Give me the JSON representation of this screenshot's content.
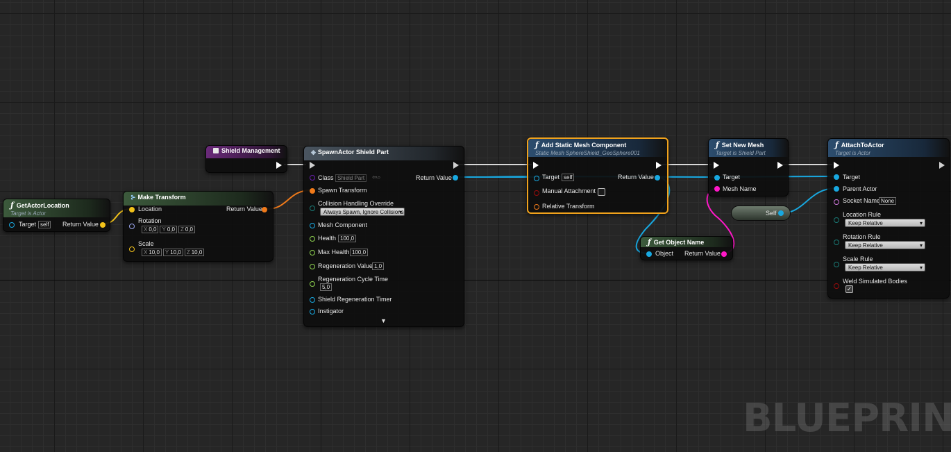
{
  "colors": {
    "exec": "#ffffff",
    "object_pin": "#18a8e0",
    "vector_pin": "#f2c21a",
    "rotator_pin": "#9aa6ee",
    "transform_pin": "#f07a1a",
    "float_pin": "#8ed250",
    "class_pin": "#6a1fb0",
    "enum_pin": "#1a7a76",
    "name_pin": "#d47ae0",
    "string_pin": "#ff18c8",
    "bool_pin": "#9a0c0c",
    "selected": "#f0a21c",
    "wire_blue": "#18a8e0",
    "wire_orange": "#f07a1a",
    "wire_yellow": "#f2c21a",
    "wire_pink": "#ff18c8"
  },
  "nodes": {
    "get_actor_location": {
      "icon": "function-icon",
      "title": "GetActorLocation",
      "subtitle": "Target is Actor",
      "target_label": "Target",
      "target_value": "self",
      "return_label": "Return Value"
    },
    "make_transform": {
      "icon": "make-struct-icon",
      "title": "Make Transform",
      "location_label": "Location",
      "rotation_label": "Rotation",
      "rotation": {
        "x": "0,0",
        "y": "0,0",
        "z": "0,0"
      },
      "scale_label": "Scale",
      "scale": {
        "x": "10,0",
        "y": "10,0",
        "z": "10,0"
      },
      "return_label": "Return Value",
      "x_label": "X",
      "y_label": "Y",
      "z_label": "Z"
    },
    "shield_management": {
      "icon": "event-icon",
      "title": "Shield Management"
    },
    "spawn_actor": {
      "icon": "spawn-icon",
      "title": "SpawnActor Shield Part",
      "class_label": "Class",
      "class_value": "Shield Part",
      "return_label": "Return Value",
      "spawn_transform_label": "Spawn Transform",
      "collision_label": "Collision Handling Override",
      "collision_value": "Always Spawn, Ignore Collisions",
      "mesh_component_label": "Mesh Component",
      "health_label": "Health",
      "health_value": "100,0",
      "max_health_label": "Max Health",
      "max_health_value": "100,0",
      "regen_value_label": "Regeneration Value",
      "regen_value": "1,0",
      "regen_cycle_label": "Regeneration Cycle Time",
      "regen_cycle_value": "5,0",
      "regen_timer_label": "Shield Regeneration Timer",
      "instigator_label": "Instigator"
    },
    "add_static_mesh": {
      "icon": "function-icon",
      "title": "Add Static Mesh Component",
      "subtitle": "Static Mesh SphereShield_GeoSphere001",
      "target_label": "Target",
      "target_value": "self",
      "return_label": "Return Value",
      "manual_attachment_label": "Manual Attachment",
      "manual_attachment_checked": false,
      "relative_transform_label": "Relative Transform"
    },
    "set_new_mesh": {
      "icon": "function-icon",
      "title": "Set New Mesh",
      "subtitle": "Target is Shield Part",
      "target_label": "Target",
      "mesh_name_label": "Mesh Name"
    },
    "get_object_name": {
      "icon": "function-icon",
      "title": "Get Object Name",
      "object_label": "Object",
      "return_label": "Return Value"
    },
    "self_ref": {
      "label": "Self"
    },
    "attach_to_actor": {
      "icon": "function-icon",
      "title": "AttachToActor",
      "subtitle": "Target is Actor",
      "target_label": "Target",
      "parent_label": "Parent Actor",
      "socket_label": "Socket Name",
      "socket_value": "None",
      "location_rule_label": "Location Rule",
      "location_rule_value": "Keep Relative",
      "rotation_rule_label": "Rotation Rule",
      "rotation_rule_value": "Keep Relative",
      "scale_rule_label": "Scale Rule",
      "scale_rule_value": "Keep Relative",
      "weld_label": "Weld Simulated Bodies",
      "weld_checked": true
    }
  },
  "watermark": "BLUEPRINT"
}
